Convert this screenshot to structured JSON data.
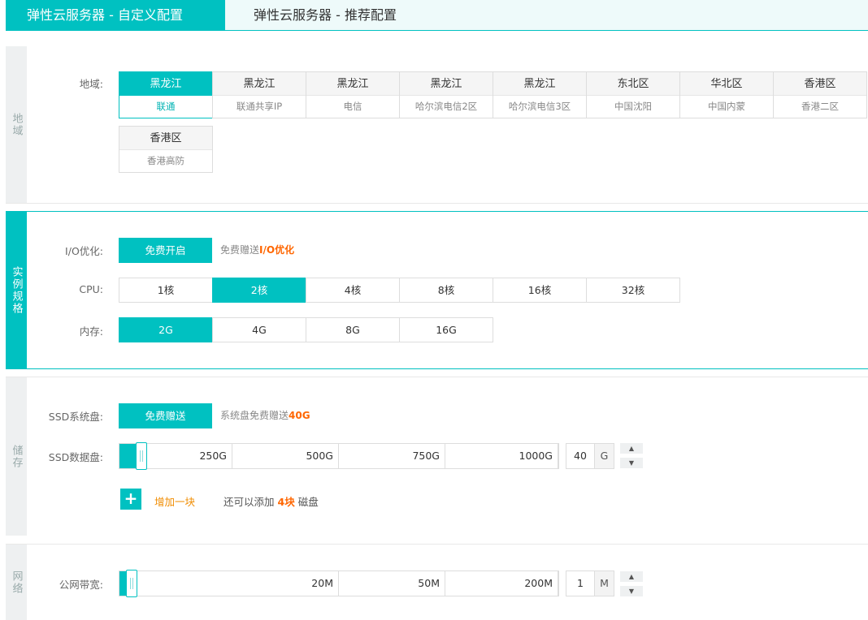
{
  "tabs": {
    "active": "弹性云服务器 - 自定义配置",
    "inactive": "弹性云服务器 - 推荐配置"
  },
  "region": {
    "side_title": "地域",
    "label": "地域:",
    "cards": [
      {
        "name": "黑龙江",
        "sub": "联通",
        "selected": true
      },
      {
        "name": "黑龙江",
        "sub": "联通共享IP"
      },
      {
        "name": "黑龙江",
        "sub": "电信"
      },
      {
        "name": "黑龙江",
        "sub": "哈尔滨电信2区"
      },
      {
        "name": "黑龙江",
        "sub": "哈尔滨电信3区"
      },
      {
        "name": "东北区",
        "sub": "中国沈阳"
      },
      {
        "name": "华北区",
        "sub": "中国内蒙"
      },
      {
        "name": "香港区",
        "sub": "香港二区"
      },
      {
        "name": "香港区",
        "sub": "香港高防"
      }
    ]
  },
  "spec": {
    "side_title": "实例规格",
    "io_label": "I/O优化:",
    "io_button": "免费开启",
    "io_note_prefix": "免费赠送",
    "io_note_strong": "I/O优化",
    "cpu_label": "CPU:",
    "cpu_options": [
      "1核",
      "2核",
      "4核",
      "8核",
      "16核",
      "32核"
    ],
    "cpu_selected": 1,
    "mem_label": "内存:",
    "mem_options": [
      "2G",
      "4G",
      "8G",
      "16G"
    ],
    "mem_selected": 0
  },
  "storage": {
    "side_title": "储存",
    "ssd_sys_label": "SSD系统盘:",
    "ssd_sys_button": "免费赠送",
    "ssd_sys_note_prefix": "系统盘免费赠送",
    "ssd_sys_note_strong": "40G",
    "ssd_data_label": "SSD数据盘:",
    "ticks": [
      "250G",
      "500G",
      "750G",
      "1000G"
    ],
    "value": "40",
    "unit": "G",
    "add_text": "增加一块",
    "remain_prefix": "还可以添加",
    "remain_strong": "4块",
    "remain_suffix": "磁盘"
  },
  "network": {
    "side_title": "网络",
    "bw_label": "公网带宽:",
    "ticks": [
      "20M",
      "50M",
      "200M"
    ],
    "value": "1",
    "unit": "M"
  },
  "icons": {
    "up": "▲",
    "down": "▼",
    "plus": "+"
  }
}
